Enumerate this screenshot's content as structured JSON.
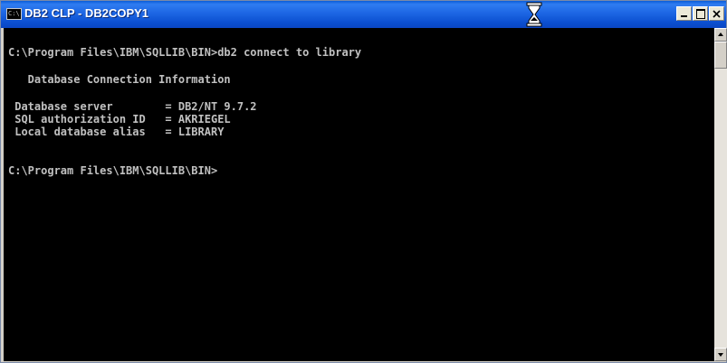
{
  "window": {
    "title": "DB2 CLP - DB2COPY1",
    "icon_text": "C:\\"
  },
  "console": {
    "lines": [
      "C:\\Program Files\\IBM\\SQLLIB\\BIN>db2 connect to library",
      "   Database Connection Information",
      " Database server        = DB2/NT 9.7.2",
      " SQL authorization ID   = AKRIEGEL",
      " Local database alias   = LIBRARY",
      "C:\\Program Files\\IBM\\SQLLIB\\BIN>"
    ]
  },
  "icons": {
    "titlebar_icon": "console-window-icon",
    "busy_cursor": "hourglass-icon",
    "minimize": "minimize-icon",
    "maximize": "maximize-icon",
    "close": "close-icon",
    "scroll_up": "triangle-up-icon",
    "scroll_down": "triangle-down-icon"
  },
  "colors": {
    "titlebar": "#1d66e4",
    "console_bg": "#000000",
    "console_text": "#c0c0c0"
  }
}
